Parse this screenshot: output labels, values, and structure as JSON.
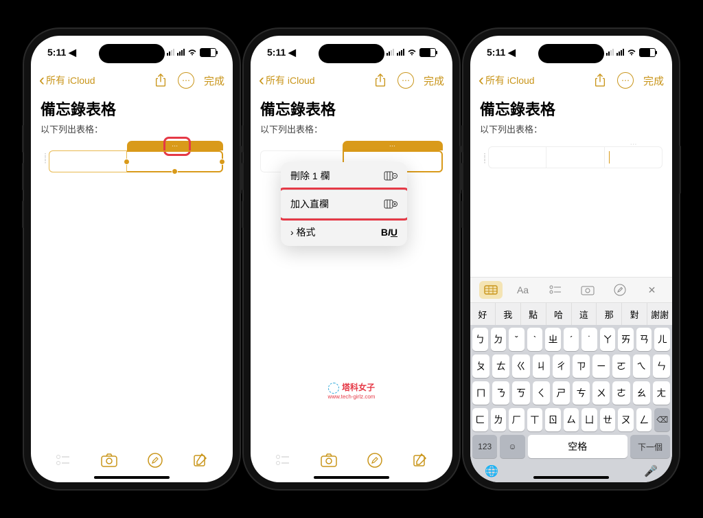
{
  "status": {
    "time": "5:11",
    "locArrow": "➤"
  },
  "nav": {
    "back": "所有 iCloud",
    "done": "完成"
  },
  "note": {
    "title": "備忘錄表格",
    "subtitle": "以下列出表格："
  },
  "menu": {
    "deleteCol": "刪除 1 欄",
    "addCol": "加入直欄",
    "format": "格式"
  },
  "watermark": {
    "main": "塔科女子",
    "sub": "www.tech-girlz.com"
  },
  "suggestions": [
    "好",
    "我",
    "點",
    "哈",
    "這",
    "那",
    "對",
    "謝謝"
  ],
  "zhuyin": {
    "r1": [
      "ㄅ",
      "ㄉ",
      "ˇ",
      "ˋ",
      "ㄓ",
      "ˊ",
      "˙",
      "ㄚ",
      "ㄞ",
      "ㄢ",
      "ㄦ"
    ],
    "r2": [
      "ㄆ",
      "ㄊ",
      "ㄍ",
      "ㄐ",
      "ㄔ",
      "ㄗ",
      "ㄧ",
      "ㄛ",
      "ㄟ",
      "ㄣ"
    ],
    "r3": [
      "ㄇ",
      "ㄋ",
      "ㄎ",
      "ㄑ",
      "ㄕ",
      "ㄘ",
      "ㄨ",
      "ㄜ",
      "ㄠ",
      "ㄤ"
    ],
    "r4": [
      "ㄈ",
      "ㄌ",
      "ㄏ",
      "ㄒ",
      "ㄖ",
      "ㄙ",
      "ㄩ",
      "ㄝ",
      "ㄡ",
      "ㄥ"
    ]
  },
  "keys": {
    "num": "123",
    "space": "空格",
    "next": "下一個"
  },
  "toolbar": {
    "Aa": "Aa"
  }
}
